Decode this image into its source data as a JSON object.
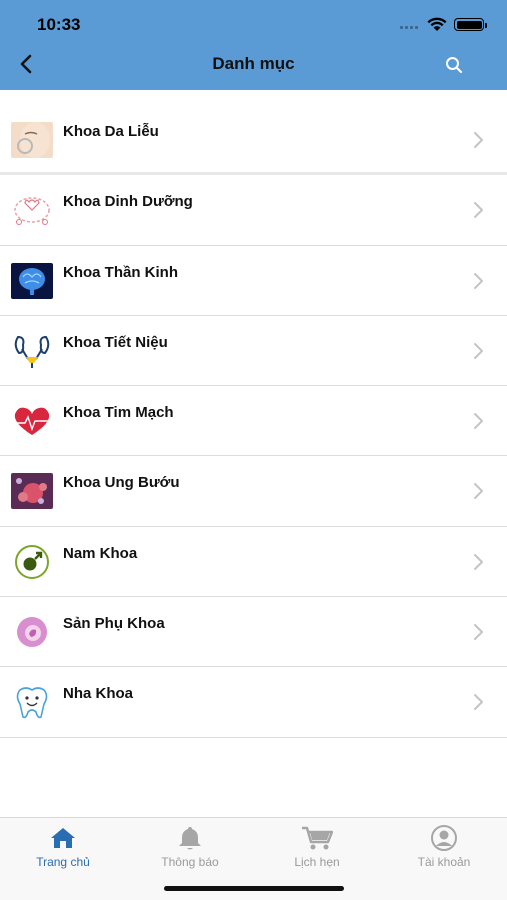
{
  "status_bar": {
    "time": "10:33"
  },
  "header": {
    "title": "Danh mục"
  },
  "categories": [
    {
      "label": "Khoa Da Liễu",
      "icon": "face-skin-icon"
    },
    {
      "label": "Khoa Dinh Dưỡng",
      "icon": "nutrition-icon"
    },
    {
      "label": "Khoa Thần Kinh",
      "icon": "brain-icon"
    },
    {
      "label": "Khoa Tiết Niệu",
      "icon": "kidney-icon"
    },
    {
      "label": "Khoa Tim Mạch",
      "icon": "heart-icon"
    },
    {
      "label": "Khoa Ung Bướu",
      "icon": "tumor-cell-icon"
    },
    {
      "label": "Nam Khoa",
      "icon": "male-symbol-icon"
    },
    {
      "label": "Sản Phụ Khoa",
      "icon": "pregnancy-icon"
    },
    {
      "label": "Nha Khoa",
      "icon": "tooth-icon"
    }
  ],
  "tabs": [
    {
      "label": "Trang chủ",
      "icon": "home-icon",
      "active": true
    },
    {
      "label": "Thông báo",
      "icon": "bell-icon",
      "active": false
    },
    {
      "label": "Lịch hẹn",
      "icon": "cart-icon",
      "active": false
    },
    {
      "label": "Tài khoản",
      "icon": "user-icon",
      "active": false
    }
  ],
  "colors": {
    "header_bg": "#5b9bd5",
    "active_tab": "#2a6db3",
    "inactive_tab": "#9a9a9a"
  }
}
